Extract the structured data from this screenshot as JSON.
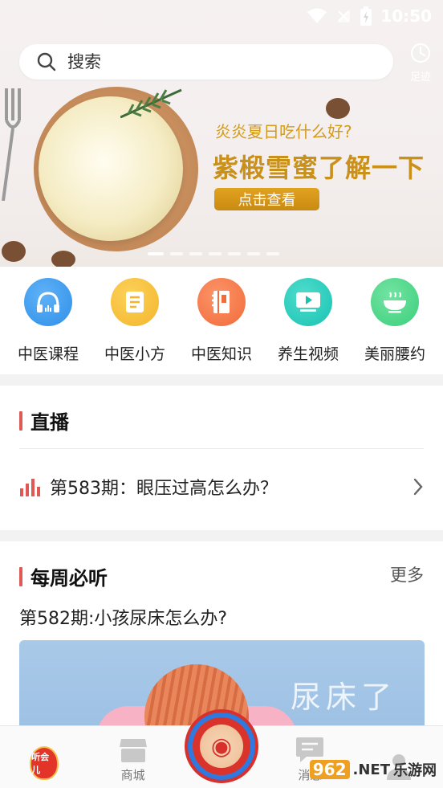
{
  "status_bar": {
    "time": "10:50"
  },
  "search": {
    "placeholder": "搜索"
  },
  "footprint": {
    "label": "足迹"
  },
  "banner": {
    "subtitle": "炎炎夏日吃什么好?",
    "headline": "紫椴雪蜜了解一下",
    "cta": "点击查看",
    "slide_count": 7,
    "active_slide": 1
  },
  "categories": [
    {
      "label": "中医课程",
      "icon": "headphones-icon",
      "color": "#2f8fe8"
    },
    {
      "label": "中医小方",
      "icon": "document-icon",
      "color": "#f4b52b"
    },
    {
      "label": "中医知识",
      "icon": "notebook-icon",
      "color": "#f26b3a"
    },
    {
      "label": "养生视频",
      "icon": "video-play-icon",
      "color": "#19c3b3"
    },
    {
      "label": "美丽腰约",
      "icon": "bowl-icon",
      "color": "#3bcf7b"
    }
  ],
  "live": {
    "title": "直播",
    "episode": "第583期：眼压过高怎么办？"
  },
  "weekly": {
    "title": "每周必听",
    "more": "更多",
    "episode": "第582期:小孩尿床怎么办?",
    "thumb_title": "尿床了"
  },
  "tabbar": {
    "items": [
      {
        "label": "",
        "badge": "听会儿",
        "icon": "listen-badge-icon",
        "active": true
      },
      {
        "label": "商城",
        "icon": "store-icon"
      },
      {
        "label": "",
        "icon": "center-feature-icon"
      },
      {
        "label": "消息",
        "icon": "message-icon"
      },
      {
        "label": "",
        "icon": "profile-icon"
      }
    ]
  },
  "watermark": {
    "brand": "962",
    "suffix": ".NET",
    "site": "乐游网"
  },
  "colors": {
    "accent": "#e05a55",
    "gold": "#c9901a",
    "tab_active": "#d8382b"
  }
}
